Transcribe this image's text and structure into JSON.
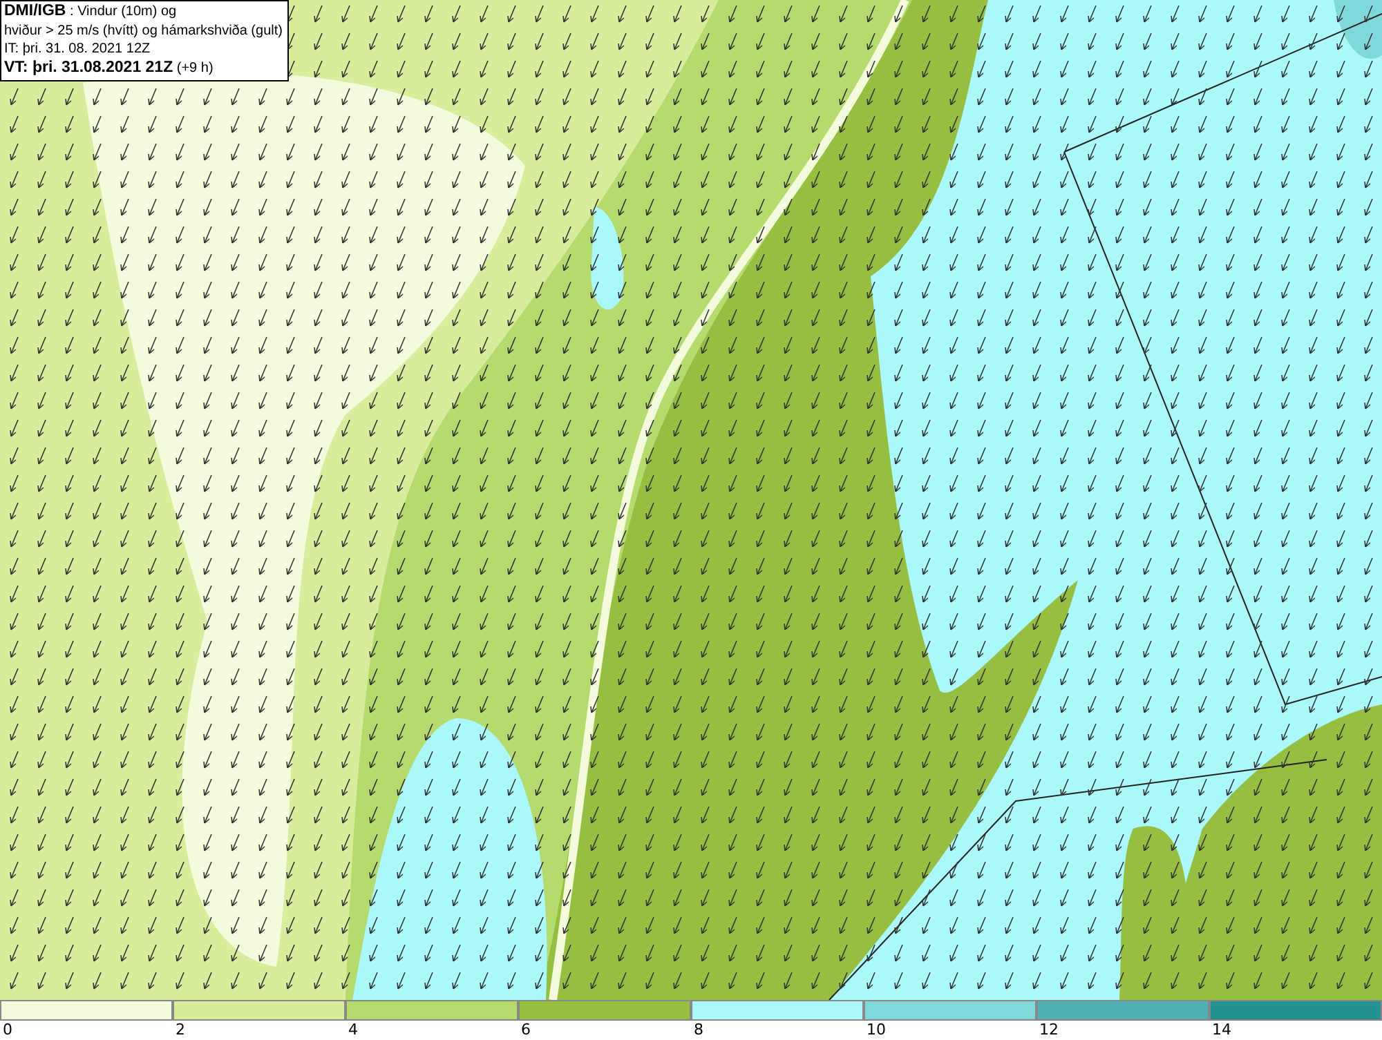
{
  "info_box": {
    "lines": [
      "**DMI/IGB** : Vindur (10m) og",
      "hviður > 25 m/s (hvítt) og hámarkshviða (gult)",
      "IT: þri. 31. 08. 2021 12Z",
      "**VT: þri. 31.08.2021 21Z** (+9 h)"
    ]
  },
  "legend": {
    "bins": [
      {
        "color": "#f4fbdc"
      },
      {
        "color": "#d7ed9c"
      },
      {
        "color": "#b5da6e"
      },
      {
        "color": "#96bf42"
      },
      {
        "color": "#abf8fb"
      },
      {
        "color": "#7fd9db"
      },
      {
        "color": "#4fb1b3"
      },
      {
        "color": "#239191"
      }
    ],
    "ticks": [
      "0",
      "2",
      "4",
      "6",
      "8",
      "10",
      "12",
      "14"
    ]
  }
}
